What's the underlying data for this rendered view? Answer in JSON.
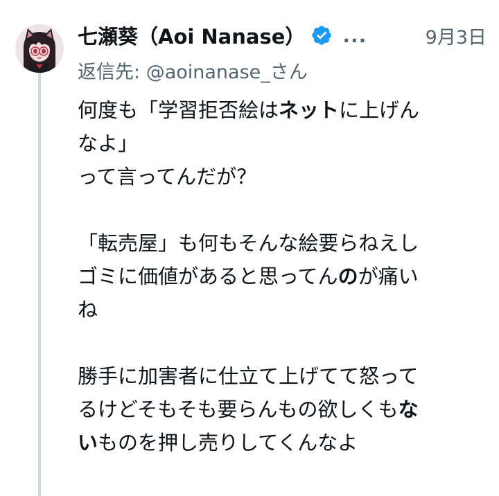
{
  "tweet": {
    "author_name": "七瀬葵（Aoi Nanase）",
    "more_indicator": "...",
    "date": "9月3日",
    "reply_prefix": "返信先: ",
    "reply_handle": "@aoinanase_さん",
    "body": {
      "p1": {
        "l1_a": "何度も「学習拒否絵は",
        "l1_b": "ネット",
        "l1_c": "に上げん",
        "l2": "なよ」",
        "l3": "って言ってんだが？"
      },
      "p2": {
        "l1": "「転売屋」も何もそんな絵要らねえし",
        "l2_a": "ゴミに価値があると思ってん",
        "l2_b": "の",
        "l2_c": "が痛い",
        "l3": "ね"
      },
      "p3": {
        "l1": "勝手に加害者に仕立て上げてて怒って",
        "l2_a": "るけどそもそも要らんもの欲しくも",
        "l2_b": "な",
        "l3_a": "い",
        "l3_b": "ものを押し売りしてくんなよ"
      }
    },
    "colors": {
      "text": "#0f1419",
      "secondary": "#536471",
      "verified": "#1d9bf0",
      "thread_line": "#cfd9de"
    },
    "icons": {
      "verified": "verified-badge-icon"
    }
  }
}
